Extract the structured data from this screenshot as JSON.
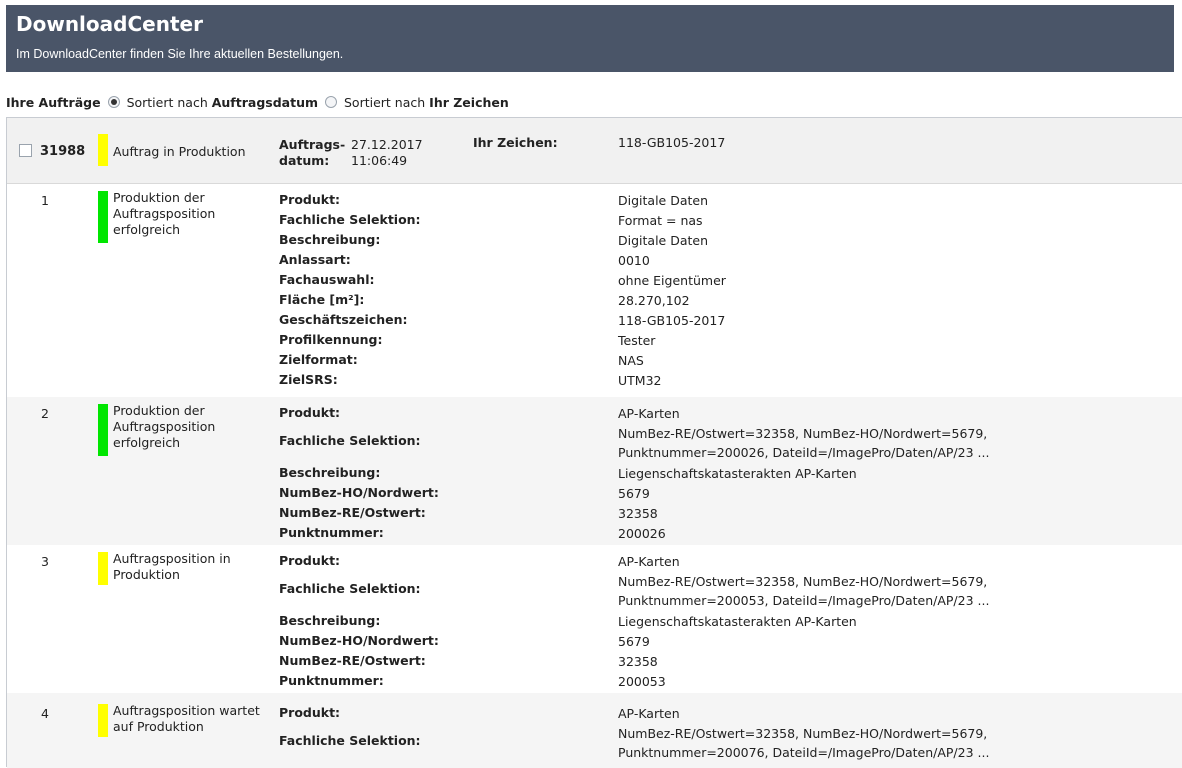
{
  "header": {
    "title": "DownloadCenter",
    "subtitle": "Im DownloadCenter finden Sie Ihre aktuellen Bestellungen."
  },
  "sort": {
    "label": "Ihre Aufträge",
    "option1_prefix": "Sortiert nach",
    "option1_bold": "Auftragsdatum",
    "option1_selected": true,
    "option2_prefix": "Sortiert nach",
    "option2_bold": "Ihr Zeichen",
    "option2_selected": false
  },
  "order": {
    "id": "31988",
    "status": "Auftrag in Produktion",
    "status_color": "#ffff00",
    "date_label_1": "Auftrags-",
    "date_label_2": "datum:",
    "date": "27.12.2017",
    "time": "11:06:49",
    "zeichen_label": "Ihr Zeichen:",
    "zeichen": "118-GB105-2017"
  },
  "positions": [
    {
      "num": "1",
      "status_lines": [
        "Produktion der",
        "Auftragsposition",
        "erfolgreich"
      ],
      "status_color": "#00e600",
      "fields": [
        {
          "label": "Produkt:",
          "value": "Digitale Daten"
        },
        {
          "label": "Fachliche Selektion:",
          "value": "Format = nas"
        },
        {
          "label": "Beschreibung:",
          "value": "Digitale Daten"
        },
        {
          "label": "Anlassart:",
          "value": "0010"
        },
        {
          "label": "Fachauswahl:",
          "value": "ohne Eigentümer"
        },
        {
          "label": "Fläche [m²]:",
          "value": "28.270,102"
        },
        {
          "label": "Geschäftszeichen:",
          "value": "118-GB105-2017"
        },
        {
          "label": "Profilkennung:",
          "value": "Tester"
        },
        {
          "label": "Zielformat:",
          "value": "NAS"
        },
        {
          "label": "ZielSRS:",
          "value": "UTM32"
        }
      ]
    },
    {
      "num": "2",
      "status_lines": [
        "Produktion der",
        "Auftragsposition",
        "erfolgreich"
      ],
      "status_color": "#00e600",
      "fields": [
        {
          "label": "Produkt:",
          "value": "AP-Karten"
        },
        {
          "label": "Fachliche Selektion:",
          "value": "NumBez-RE/Ostwert=32358, NumBez-HO/Nordwert=5679,",
          "value2": "Punktnummer=200026, DateiId=/ImagePro/Daten/AP/23 ..."
        },
        {
          "label": "Beschreibung:",
          "value": "Liegenschaftskatasterakten AP-Karten"
        },
        {
          "label": "NumBez-HO/Nordwert:",
          "value": "5679"
        },
        {
          "label": "NumBez-RE/Ostwert:",
          "value": "32358"
        },
        {
          "label": "Punktnummer:",
          "value": "200026"
        }
      ]
    },
    {
      "num": "3",
      "status_lines": [
        "Auftragsposition in",
        "Produktion"
      ],
      "status_color": "#ffff00",
      "fields": [
        {
          "label": "Produkt:",
          "value": "AP-Karten"
        },
        {
          "label": "Fachliche Selektion:",
          "value": "NumBez-RE/Ostwert=32358, NumBez-HO/Nordwert=5679,",
          "value2": "Punktnummer=200053, DateiId=/ImagePro/Daten/AP/23 ..."
        },
        {
          "label": "Beschreibung:",
          "value": "Liegenschaftskatasterakten AP-Karten"
        },
        {
          "label": "NumBez-HO/Nordwert:",
          "value": "5679"
        },
        {
          "label": "NumBez-RE/Ostwert:",
          "value": "32358"
        },
        {
          "label": "Punktnummer:",
          "value": "200053"
        }
      ]
    },
    {
      "num": "4",
      "status_lines": [
        "Auftragsposition wartet",
        "auf Produktion"
      ],
      "status_color": "#ffff00",
      "fields": [
        {
          "label": "Produkt:",
          "value": "AP-Karten"
        },
        {
          "label": "Fachliche Selektion:",
          "value": "NumBez-RE/Ostwert=32358, NumBez-HO/Nordwert=5679,",
          "value2": "Punktnummer=200076, DateiId=/ImagePro/Daten/AP/23 ..."
        }
      ]
    }
  ]
}
